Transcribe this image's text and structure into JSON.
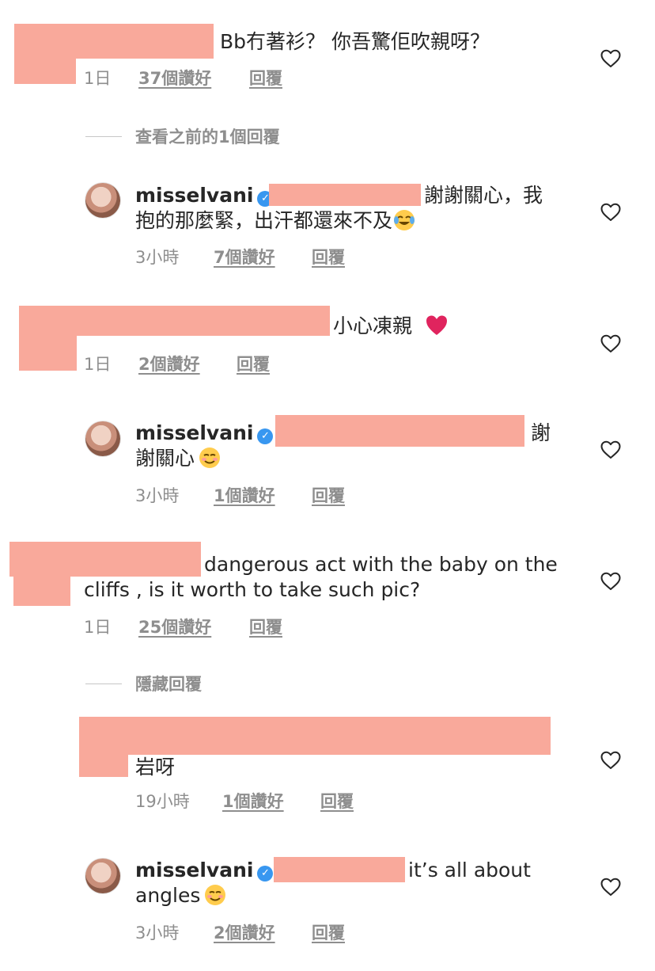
{
  "comments": [
    {
      "text": "Bb冇著衫？ 你吾驚佢吹親呀？",
      "time": "1日",
      "likes": "37個讚好",
      "reply": "回覆"
    },
    {
      "toggle": "查看之前的1個回覆"
    },
    {
      "username": "misselvani",
      "text_line1": "謝謝關心，我",
      "text_line2": "抱的那麼緊，出汗都還來不及",
      "time": "3小時",
      "likes": "7個讚好",
      "reply": "回覆"
    },
    {
      "text": "小心凍親",
      "time": "1日",
      "likes": "2個讚好",
      "reply": "回覆"
    },
    {
      "username": "misselvani",
      "text_line1": "謝",
      "text_line2": "謝關心",
      "time": "3小時",
      "likes": "1個讚好",
      "reply": "回覆"
    },
    {
      "text_line1": "dangerous act with the baby on the",
      "text_line2": "cliffs , is it worth to take such pic?",
      "time": "1日",
      "likes": "25個讚好",
      "reply": "回覆"
    },
    {
      "toggle": "隱藏回覆"
    },
    {
      "text": "岩呀",
      "time": "19小時",
      "likes": "1個讚好",
      "reply": "回覆"
    },
    {
      "username": "misselvani",
      "text_line1": "it’s all about",
      "text_line2": "angles",
      "time": "3小時",
      "likes": "2個讚好",
      "reply": "回覆"
    }
  ],
  "icons": {
    "like": "heart-outline-icon",
    "verified": "verified-badge-icon"
  },
  "colors": {
    "text": "#262626",
    "secondary": "#8e8e8e",
    "verified": "#3897f0",
    "redaction": "#f9a99b",
    "heart_emoji": "#e0245e"
  }
}
